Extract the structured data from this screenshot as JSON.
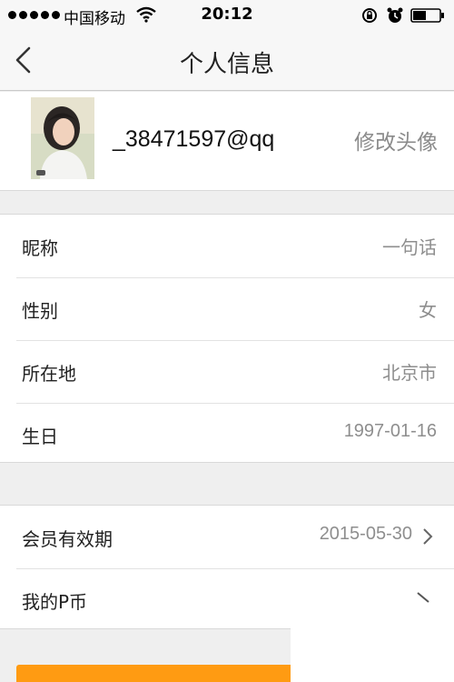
{
  "status_bar": {
    "carrier": "中国移动",
    "time": "20:12",
    "signal_icon": "signal-dots-icon",
    "wifi_icon": "wifi-icon",
    "lock_icon": "rotation-lock-icon",
    "alarm_icon": "alarm-clock-icon",
    "battery_icon": "battery-icon"
  },
  "nav": {
    "title": "个人信息",
    "back_icon": "chevron-left-icon"
  },
  "profile": {
    "username": "_38471597@qq",
    "change_avatar_label": "修改头像",
    "avatar_icon": "avatar-photo"
  },
  "info_rows": [
    {
      "label": "昵称",
      "value": "一句话"
    },
    {
      "label": "性别",
      "value": "女"
    },
    {
      "label": "所在地",
      "value": "北京市"
    },
    {
      "label": "生日",
      "value": "1997-01-16"
    }
  ],
  "member_rows": [
    {
      "label": "会员有效期",
      "value": "2015-05-30",
      "icon": "chevron-right-icon"
    },
    {
      "label": "我的P币",
      "value": "",
      "icon": "chevron-icon"
    }
  ],
  "colors": {
    "accent": "#ff9b12",
    "background": "#efefef",
    "secondary_text": "#8e8e8e"
  }
}
